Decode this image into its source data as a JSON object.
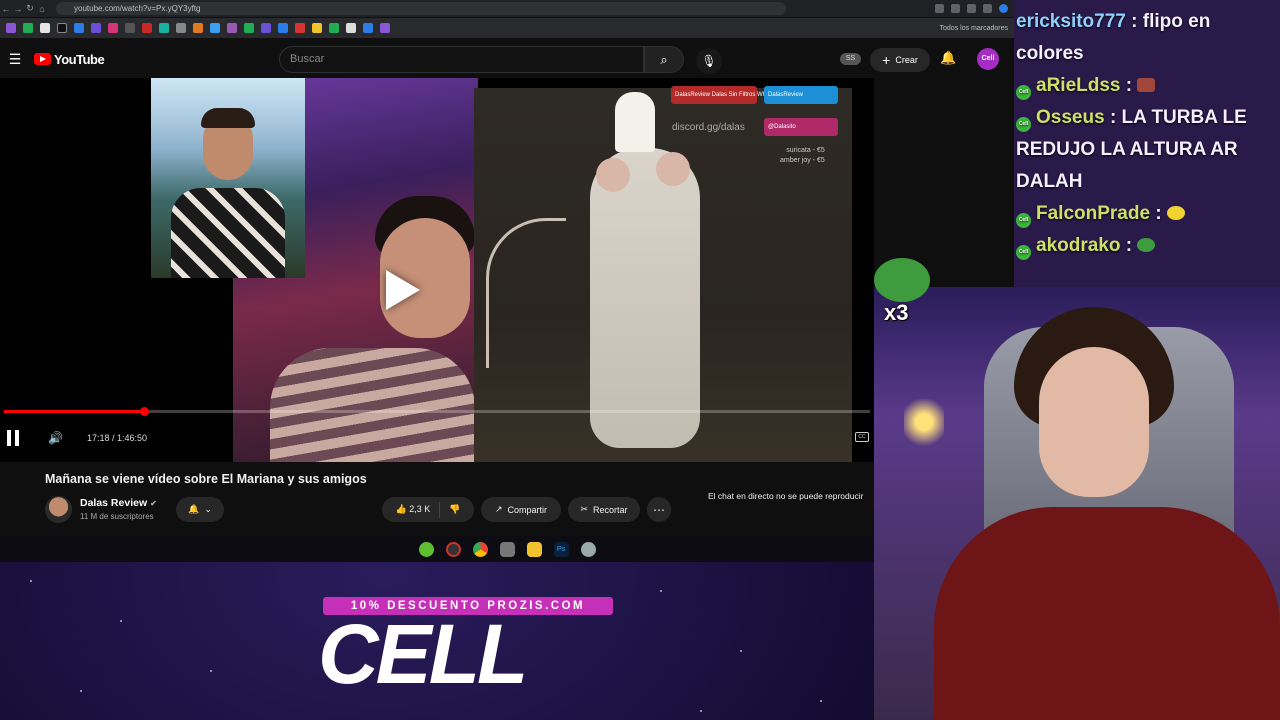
{
  "browser": {
    "url": "youtube.com/watch?v=Px.yQY3yftg",
    "bookmarks_folder": "Todos los marcadores"
  },
  "youtube": {
    "logo_text": "YouTube",
    "search_placeholder": "Buscar",
    "ss_badge": "SS",
    "create_label": "Crear",
    "avatar_text": "Cell"
  },
  "player": {
    "current_time": "17:18",
    "duration": "1:46:50",
    "time_display": "17:18 / 1:46:50",
    "progress_fraction": 0.1619,
    "promo_youtube": "DalasReview Dalas Sin Filtros WhoTheDame",
    "promo_twitter": "DalasReview",
    "promo_instagram": "@Dalasito",
    "discord": "discord.gg/dalas",
    "donation_1": "suricata - €5",
    "donation_2": "amber joy - €5"
  },
  "video": {
    "title": "Mañana se viene vídeo sobre El Mariana y sus amigos",
    "channel_name": "Dalas Review",
    "subscribers": "11 M de suscriptores",
    "likes": "2,3 K",
    "share_label": "Compartir",
    "clip_label": "Recortar",
    "chat_disabled": "El chat en directo no se puede reproducir"
  },
  "chat": {
    "messages": [
      {
        "user": "ericksito777",
        "text": ": flipo en colores"
      },
      {
        "user": "aRieLdss",
        "text": ":"
      },
      {
        "user": "Osseus",
        "text": ": LA TURBA LE REDUJO LA ALTURA AR DALAH"
      },
      {
        "user": "FalconPrade",
        "text": ":"
      },
      {
        "user": "akodrako",
        "text": ":"
      }
    ]
  },
  "overlay": {
    "emote_multiplier": "x3",
    "sponsor_code": "10% DESCUENTO PROZIS.COM",
    "sponsor_name": "CELL"
  },
  "colors": {
    "youtube_red": "#ff0000",
    "chat_bg": "#2a1a4a",
    "sponsor_pink": "#c62fb7",
    "username_yellow": "#cfe06a"
  }
}
